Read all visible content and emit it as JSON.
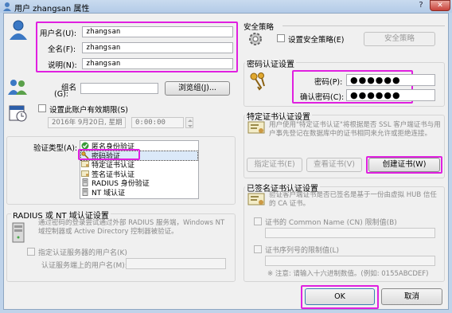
{
  "window": {
    "title": "用户 zhangsan 属性",
    "close_glyph": "✕",
    "help_glyph": "?"
  },
  "user": {
    "username_label": "用户名(U):",
    "username_value": "zhangsan",
    "fullname_label": "全名(F):",
    "fullname_value": "zhangsan",
    "description_label": "说明(N):",
    "description_value": "zhangsan"
  },
  "group": {
    "label_line1": "组名",
    "label_line2": "(G):",
    "value": "",
    "browse_button": "浏览组(J)..."
  },
  "expiry": {
    "checkbox_label": "设置此账户有效期限(S)",
    "date": "2016年 9月20日, 星期",
    "time": "0:00:00"
  },
  "auth": {
    "type_label": "验证类型(A):",
    "options": [
      {
        "label": "匿名身份验证",
        "icon": "check-icon"
      },
      {
        "label": "密码验证",
        "icon": "key-icon"
      },
      {
        "label": "特定证书认证",
        "icon": "certificate-icon"
      },
      {
        "label": "签名证书认证",
        "icon": "certificate-icon"
      },
      {
        "label": "RADIUS 身份验证",
        "icon": "server-icon"
      },
      {
        "label": "NT 域认证",
        "icon": "server-icon"
      }
    ],
    "selected_index": 1
  },
  "radius": {
    "title": "RADIUS 或 NT 域认证设置",
    "description": "通过密码的登录尝试通过外部 RADIUS 服务端，Windows NT 域控制器或 Active Directory 控制器被验证。",
    "specify_checkbox": "指定认证服务器的用户名(K)",
    "server_username_label": "认证服务端上的用户名(M):",
    "server_username_value": ""
  },
  "security": {
    "title": "安全策略",
    "checkbox_label": "设置安全策略(E)",
    "button": "安全策略"
  },
  "password": {
    "title": "密码认证设置",
    "password_label": "密码(P):",
    "password_value": "●●●●●●",
    "confirm_label": "确认密码(C):",
    "confirm_value": "●●●●●●"
  },
  "cert": {
    "title": "特定证书认证设置",
    "description": "用户使用\"特定证书认证\"将根据是否 SSL 客户端证书与用户事先登记在数据库中的证书相同来允许或拒绝连接。",
    "specify_button": "指定证书(E)",
    "view_button": "查看证书(V)",
    "create_button": "创建证书(W)"
  },
  "signed": {
    "title": "已签名证书认证设置",
    "description": "验证客户端证书是否已签名是基于一份由虚拟 HUB 信任的 CA 证书。",
    "cn_checkbox": "证书的 Common Name (CN) 限制值(B)",
    "cn_value": "",
    "serial_checkbox": "证书序列号的限制值(L)",
    "serial_value": "",
    "note": "※ 注意: 请输入十六进制数值。(例如: 0155ABCDEF)"
  },
  "footer": {
    "ok": "OK",
    "cancel": "取消"
  },
  "colors": {
    "highlight": "#e020e0",
    "title_bar": "#bfd3ea",
    "close_button": "#c8423a"
  }
}
